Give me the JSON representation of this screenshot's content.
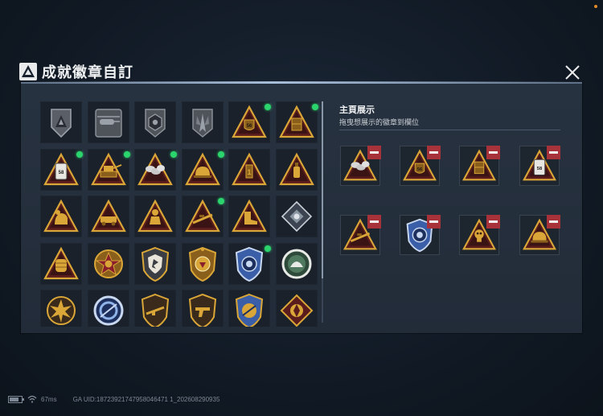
{
  "title": "成就徽章自訂",
  "showcase": {
    "title": "主頁展示",
    "subtitle": "拖曳想展示的徽章到欄位",
    "slots": [
      {
        "badge": "grenade-bundle-badge-icon"
      },
      {
        "badge": "shield-56-badge-icon"
      },
      {
        "badge": "crate-badge-icon"
      },
      {
        "badge": "magazine-58-badge-icon"
      },
      {
        "badge": "sniper-badge-icon"
      },
      {
        "badge": "blue-star-medal-badge-icon"
      },
      {
        "badge": "skull-badge-icon"
      },
      {
        "badge": "helmet-badge-icon"
      }
    ]
  },
  "badges": [
    {
      "icon": "elite-emblem-badge-icon",
      "new": false
    },
    {
      "icon": "helicopter-emblem-badge-icon",
      "new": false
    },
    {
      "icon": "hex-emblem-badge-icon",
      "new": false
    },
    {
      "icon": "wings-emblem-badge-icon",
      "new": false
    },
    {
      "icon": "shield-56-badge-icon",
      "new": true
    },
    {
      "icon": "crate-badge-icon",
      "new": true
    },
    {
      "icon": "magazine-58-badge-icon",
      "new": true
    },
    {
      "icon": "turret-badge-icon",
      "new": true
    },
    {
      "icon": "grenade-bundle-badge-icon",
      "new": true
    },
    {
      "icon": "helmet-badge-icon",
      "new": true
    },
    {
      "icon": "first-place-badge-icon",
      "new": false
    },
    {
      "icon": "bottle-badge-icon",
      "new": false
    },
    {
      "icon": "bear-badge-icon",
      "new": false
    },
    {
      "icon": "vehicle-badge-icon",
      "new": false
    },
    {
      "icon": "soldier-badge-icon",
      "new": false
    },
    {
      "icon": "sniper-badge-icon",
      "new": true
    },
    {
      "icon": "boot-badge-icon",
      "new": false
    },
    {
      "icon": "silver-diamond-badge-icon",
      "new": false
    },
    {
      "icon": "fist-badge-icon",
      "new": false
    },
    {
      "icon": "star-medal-badge-icon",
      "new": false
    },
    {
      "icon": "shield-medal-badge-icon",
      "new": false
    },
    {
      "icon": "gold-star-medal-badge-icon",
      "new": false
    },
    {
      "icon": "blue-star-medal-badge-icon",
      "new": true
    },
    {
      "icon": "green-circle-badge-icon",
      "new": false
    },
    {
      "icon": "explosion-badge-icon",
      "new": false
    },
    {
      "icon": "blue-ring-badge-icon",
      "new": false
    },
    {
      "icon": "rifle-badge-icon",
      "new": false
    },
    {
      "icon": "pistol-badge-icon",
      "new": false
    },
    {
      "icon": "gold-shield-badge-icon",
      "new": false
    },
    {
      "icon": "red-diamond-badge-icon",
      "new": false
    }
  ],
  "status": {
    "ping": "67ms",
    "uid": "GA UID:18723921747958046471 1_202608290935"
  },
  "colors": {
    "gold": "#d9a637",
    "dark_gold": "#8a5f1c",
    "red": "#a8323a",
    "green": "#2bd46d",
    "blue": "#3b5ea8"
  }
}
